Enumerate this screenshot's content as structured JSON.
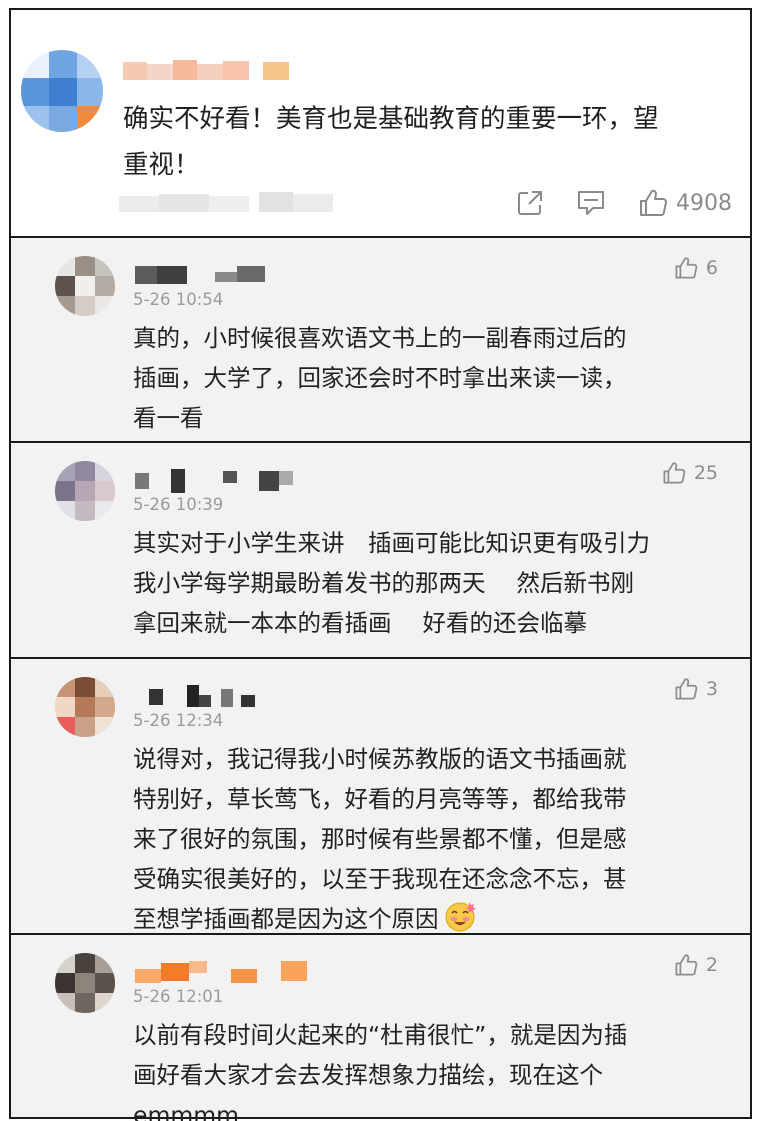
{
  "main_comment": {
    "text_line1": "确实不好看！美育也是基础教育的重要一环，望",
    "text_line2": "重视！",
    "actions": [
      {
        "icon": "share-icon"
      },
      {
        "icon": "comment-icon"
      },
      {
        "icon": "thumbs-up-icon",
        "count": "4908"
      }
    ]
  },
  "replies": [
    {
      "time": "5-26 10:54",
      "likes": "6",
      "lines": [
        "真的，小时候很喜欢语文书上的一副春雨过后的",
        "插画，大学了，回家还会时不时拿出来读一读，",
        "看一看"
      ]
    },
    {
      "time": "5-26 10:39",
      "likes": "25",
      "lines": [
        "其实对于小学生来讲　插画可能比知识更有吸引力",
        "我小学每学期最盼着发书的那两天　 然后新书刚",
        "拿回来就一本本的看插画　 好看的还会临摹"
      ]
    },
    {
      "time": "5-26 12:34",
      "likes": "3",
      "lines": [
        "说得对，我记得我小时候苏教版的语文书插画就",
        "特别好，草长莺飞，好看的月亮等等，都给我带",
        "来了很好的氛围，那时候有些景都不懂，但是感",
        "受确实很美好的，以至于我现在还念念不忘，甚",
        "至想学插画都是因为这个原因"
      ],
      "emoji": "smiling-emoji-icon"
    },
    {
      "time": "5-26 12:01",
      "likes": "2",
      "lines": [
        "以前有段时间火起来的“杜甫很忙”，就是因为插",
        "画好看大家才会去发挥想象力描绘，现在这个",
        "emmmm"
      ]
    }
  ],
  "colors": {
    "reply_bg": "#f2f2f2",
    "divider": "#1a1a1a",
    "meta_gray": "#9a9a9a",
    "icon_gray": "#8a8a8a"
  }
}
